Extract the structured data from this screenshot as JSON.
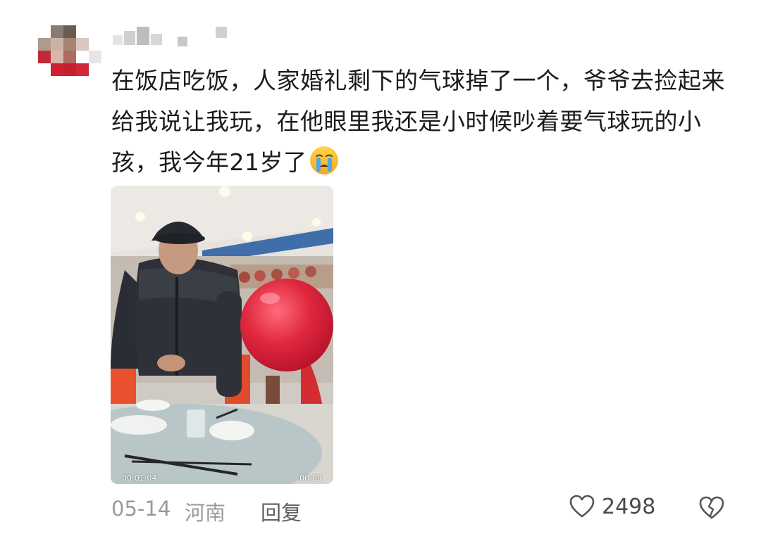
{
  "comment": {
    "author_name": "",
    "text": "在饭店吃饭，人家婚礼剩下的气球掉了一个，爷爷去捡起来给我说让我玩，在他眼里我还是小时候吵着要气球玩的小孩，我今年21岁了",
    "emoji": "crying-face-emoji"
  },
  "video": {
    "current_time": "00:01:04",
    "duration": "00:09"
  },
  "footer": {
    "date": "05-14",
    "location": "河南",
    "reply_label": "回复",
    "like_count": "2498"
  },
  "colors": {
    "balloon": "#e0283e",
    "muted_text": "#9a9a9a",
    "reply_text": "#606060"
  }
}
